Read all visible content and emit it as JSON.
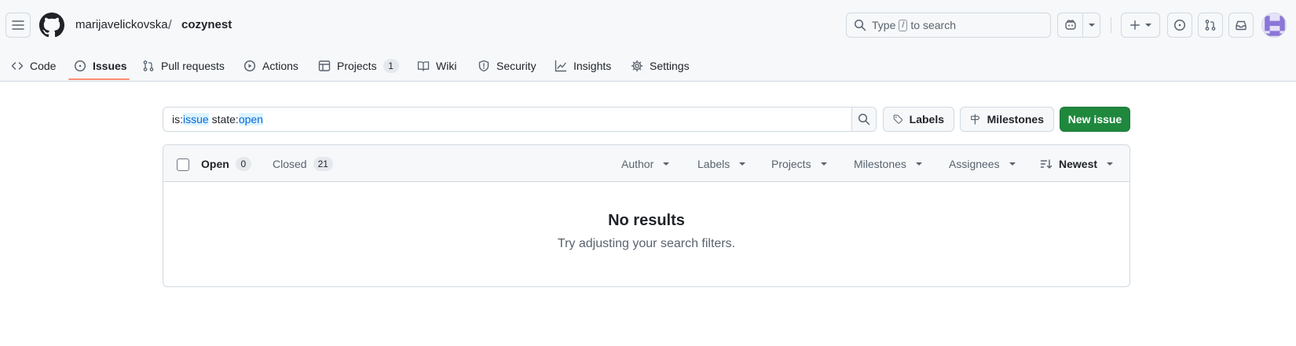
{
  "breadcrumb": {
    "owner": "marijavelickovska",
    "separator": "/",
    "repo": "cozynest"
  },
  "search": {
    "prefix": "Type",
    "key": "/",
    "suffix": "to search"
  },
  "nav": {
    "tabs": [
      {
        "label": "Code"
      },
      {
        "label": "Issues"
      },
      {
        "label": "Pull requests"
      },
      {
        "label": "Actions"
      },
      {
        "label": "Projects",
        "count": "1"
      },
      {
        "label": "Wiki"
      },
      {
        "label": "Security"
      },
      {
        "label": "Insights"
      },
      {
        "label": "Settings"
      }
    ]
  },
  "filter": {
    "t1": "is:",
    "t2": "issue",
    "t3": " state:",
    "t4": "open"
  },
  "buttons": {
    "labels": "Labels",
    "milestones": "Milestones",
    "new_issue": "New issue"
  },
  "list": {
    "open_label": "Open",
    "open_count": "0",
    "closed_label": "Closed",
    "closed_count": "21",
    "filters": [
      "Author",
      "Labels",
      "Projects",
      "Milestones",
      "Assignees"
    ],
    "sort": "Newest"
  },
  "blankslate": {
    "title": "No results",
    "subtitle": "Try adjusting your search filters."
  },
  "colors": {
    "accent_underline": "#fd8c73",
    "primary_button": "#1f883d",
    "link": "#0969da"
  }
}
